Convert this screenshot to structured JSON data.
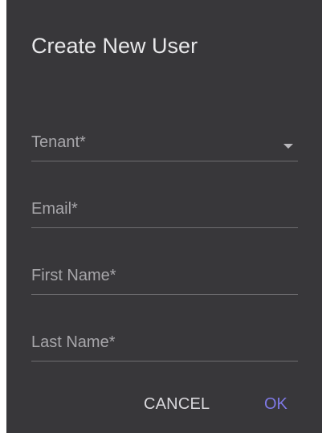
{
  "dialog": {
    "title": "Create New User",
    "fields": {
      "tenant": {
        "label": "Tenant*",
        "value": ""
      },
      "email": {
        "label": "Email*",
        "value": ""
      },
      "first_name": {
        "label": "First Name*",
        "value": ""
      },
      "last_name": {
        "label": "Last Name*",
        "value": ""
      }
    },
    "actions": {
      "cancel_label": "CANCEL",
      "ok_label": "OK"
    },
    "icons": {
      "tenant_dropdown": "dropdown-caret-icon"
    },
    "colors": {
      "background": "#38373a",
      "accent": "#7f79e6"
    }
  }
}
